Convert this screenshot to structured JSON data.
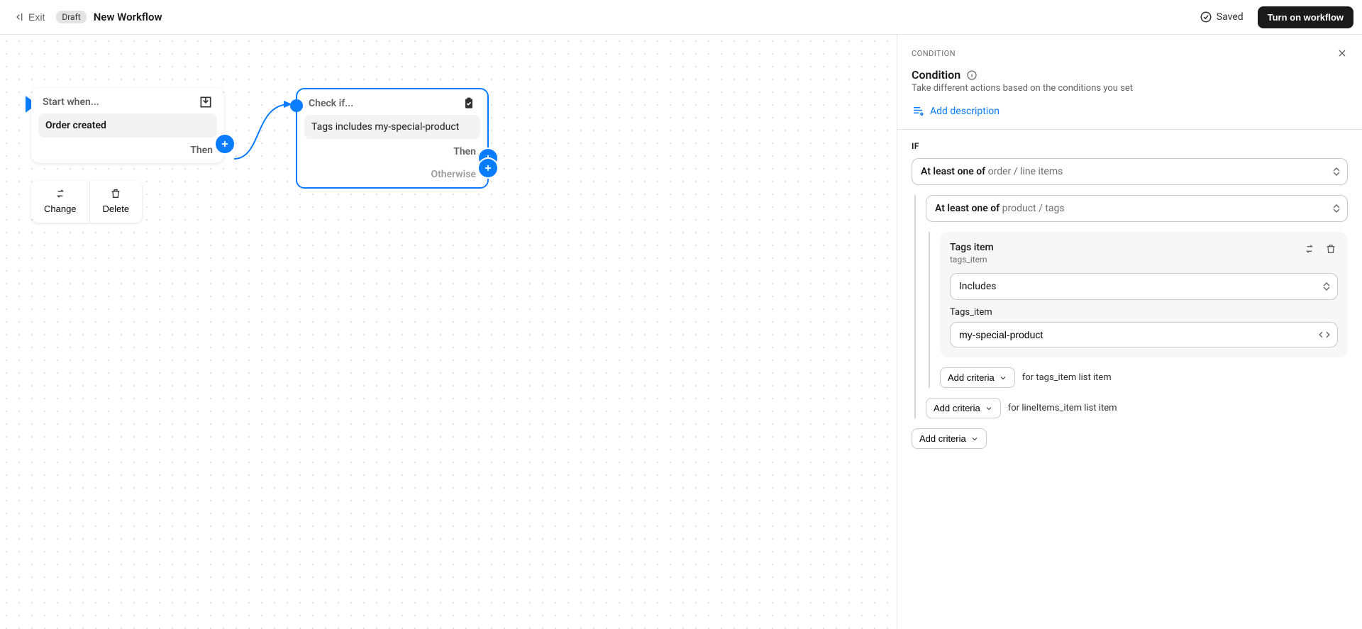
{
  "topbar": {
    "exit": "Exit",
    "status_badge": "Draft",
    "workflow_title": "New Workflow",
    "saved": "Saved",
    "turn_on": "Turn on workflow"
  },
  "canvas": {
    "trigger": {
      "header": "Start when...",
      "event": "Order created",
      "then": "Then"
    },
    "condition": {
      "header": "Check if...",
      "summary": "Tags includes my-special-product",
      "then": "Then",
      "otherwise": "Otherwise"
    },
    "toolbox": {
      "change": "Change",
      "delete": "Delete"
    }
  },
  "panel": {
    "kicker": "CONDITION",
    "title": "Condition",
    "subtitle": "Take different actions based on the conditions you set",
    "add_description": "Add description",
    "if_label": "IF",
    "outer_select_prefix": "At least one of ",
    "outer_select_value": "order / line items",
    "inner_select_prefix": "At least one of ",
    "inner_select_value": "product / tags",
    "criteria": {
      "title": "Tags item",
      "code": "tags_item",
      "operator": "Includes",
      "value_label": "Tags_item",
      "value": "my-special-product"
    },
    "add_criteria": "Add criteria",
    "for_tags": "for tags_item list item",
    "for_lineitems": "for lineItems_item list item"
  }
}
